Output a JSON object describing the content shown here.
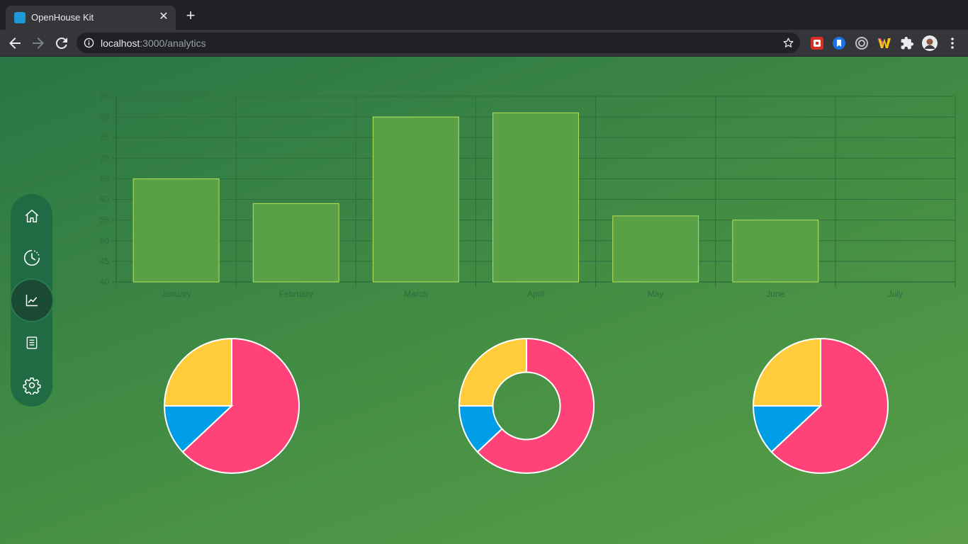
{
  "browser": {
    "tab_title": "OpenHouse Kit",
    "tab_close": "✕",
    "new_tab": "+",
    "url_host": "localhost",
    "url_path": ":3000/analytics"
  },
  "sidebar": {
    "items": [
      {
        "name": "home",
        "icon": "home-icon"
      },
      {
        "name": "history",
        "icon": "clock-icon"
      },
      {
        "name": "analytics",
        "icon": "chart-line-icon",
        "active": true
      },
      {
        "name": "reports",
        "icon": "document-icon"
      },
      {
        "name": "settings",
        "icon": "gear-icon"
      }
    ]
  },
  "colors": {
    "bar_fill": "#5aa047",
    "bar_border": "#b5e35a",
    "pie_pink": "#ff4379",
    "pie_blue": "#019ee8",
    "pie_yellow": "#ffcd3c",
    "axis_text": "#306b3d",
    "grid": "#2f6e3a"
  },
  "chart_data": [
    {
      "type": "bar",
      "categories": [
        "January",
        "February",
        "March",
        "April",
        "May",
        "June",
        "July"
      ],
      "values": [
        65,
        59,
        80,
        81,
        56,
        55,
        null
      ],
      "ylim": [
        40,
        85
      ],
      "yticks": [
        40,
        45,
        50,
        55,
        60,
        65,
        70,
        75,
        80,
        85
      ],
      "grid": true
    },
    {
      "type": "pie",
      "values": [
        63,
        12,
        25
      ],
      "colors": [
        "#ff4379",
        "#019ee8",
        "#ffcd3c"
      ]
    },
    {
      "type": "pie",
      "variant": "doughnut",
      "values": [
        63,
        12,
        25
      ],
      "colors": [
        "#ff4379",
        "#019ee8",
        "#ffcd3c"
      ]
    },
    {
      "type": "pie",
      "values": [
        63,
        12,
        25
      ],
      "colors": [
        "#ff4379",
        "#019ee8",
        "#ffcd3c"
      ]
    }
  ]
}
